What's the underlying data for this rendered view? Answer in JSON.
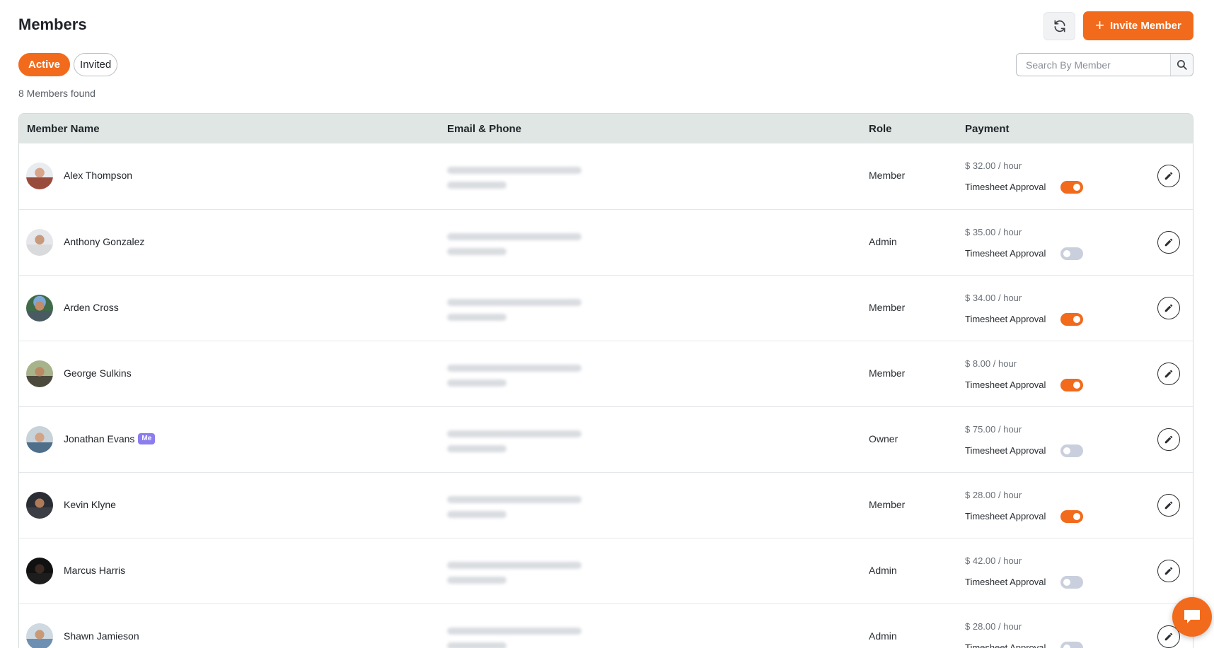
{
  "header": {
    "title": "Members",
    "invite_label": "Invite Member",
    "refresh_icon": "refresh-icon",
    "accent_color": "#f26a1b"
  },
  "tabs": [
    {
      "label": "Active",
      "selected": true
    },
    {
      "label": "Invited",
      "selected": false
    }
  ],
  "search": {
    "placeholder": "Search By Member",
    "value": ""
  },
  "count_text": "8 Members found",
  "table": {
    "columns": [
      "Member Name",
      "Email & Phone",
      "Role",
      "Payment"
    ],
    "timesheet_label": "Timesheet Approval",
    "rows": [
      {
        "name": "Alex Thompson",
        "me": false,
        "role": "Member",
        "rate": "$ 32.00 / hour",
        "timesheet_approval": true
      },
      {
        "name": "Anthony Gonzalez",
        "me": false,
        "role": "Admin",
        "rate": "$ 35.00 / hour",
        "timesheet_approval": false
      },
      {
        "name": "Arden Cross",
        "me": false,
        "role": "Member",
        "rate": "$ 34.00 / hour",
        "timesheet_approval": true
      },
      {
        "name": "George Sulkins",
        "me": false,
        "role": "Member",
        "rate": "$ 8.00 / hour",
        "timesheet_approval": true
      },
      {
        "name": "Jonathan Evans",
        "me": true,
        "me_label": "Me",
        "role": "Owner",
        "rate": "$ 75.00 / hour",
        "timesheet_approval": false
      },
      {
        "name": "Kevin Klyne",
        "me": false,
        "role": "Member",
        "rate": "$ 28.00 / hour",
        "timesheet_approval": true
      },
      {
        "name": "Marcus Harris",
        "me": false,
        "role": "Admin",
        "rate": "$ 42.00 / hour",
        "timesheet_approval": false
      },
      {
        "name": "Shawn Jamieson",
        "me": false,
        "role": "Admin",
        "rate": "$ 28.00 / hour",
        "timesheet_approval": false
      }
    ]
  }
}
